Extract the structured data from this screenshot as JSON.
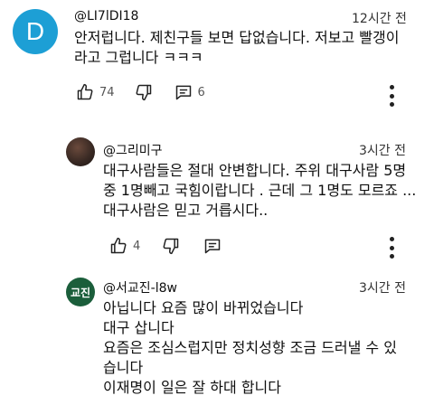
{
  "comments": [
    {
      "avatar_letter": "D",
      "avatar_color": "#1d9fd5",
      "author": "@LI7lDI18",
      "time": "12시간 전",
      "lines": [
        "안저럽니다. 제친구들 보면 답없습니다. 저보고 빨갱이",
        "라고 그럽니다 ㅋㅋㅋ"
      ],
      "likes": "74",
      "replies": "6"
    },
    {
      "avatar_color": "#3a2a24",
      "author": "@그리미구",
      "time": "3시간 전",
      "lines": [
        "대구사람들은 절대 안변합니다. 주위 대구사람 5명",
        "중 1명빼고 국힘이랍니다 . 근데 그 1명도 모르죠 ...",
        "대구사람은 믿고 거릅시다.."
      ],
      "likes": "4"
    },
    {
      "avatar_text": "교진",
      "avatar_color": "#1b5e3b",
      "author": "@서교진-l8w",
      "time": "3시간 전",
      "lines": [
        "아닙니다 요즘 많이 바뀌었습니다",
        "대구 삽니다",
        "요즘은 조심스럽지만 정치성향 조금 드러낼 수 있",
        "습니다",
        "이재명이 일은 잘 하대 합니다"
      ]
    }
  ],
  "icons": {
    "like": "thumbs-up-icon",
    "dislike": "thumbs-down-icon",
    "reply": "comment-icon",
    "more": "more-vertical-icon"
  }
}
